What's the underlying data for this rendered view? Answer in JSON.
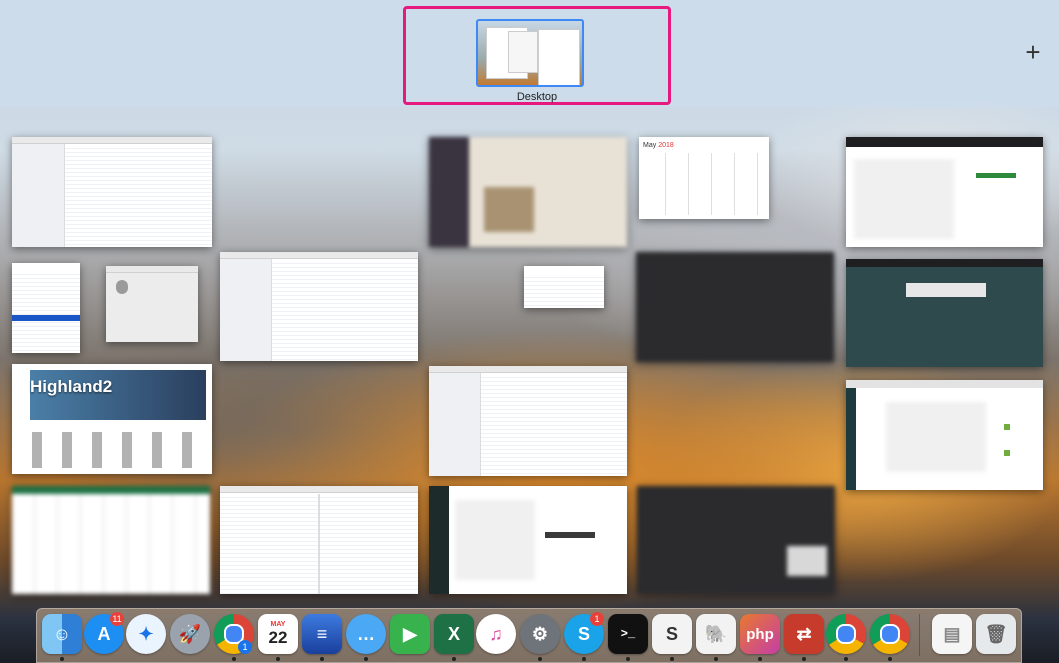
{
  "spaces": {
    "desktop_label": "Desktop",
    "add_button": "+"
  },
  "windows": {
    "highland_title": "Highland2",
    "calendar_month": "May",
    "calendar_year": "2018"
  },
  "dock": {
    "items": [
      {
        "name": "Finder",
        "icon": "finder-icon"
      },
      {
        "name": "App Store",
        "icon": "app-store-icon",
        "badge": "11"
      },
      {
        "name": "Safari",
        "icon": "safari-icon"
      },
      {
        "name": "Launchpad",
        "icon": "launchpad-icon"
      },
      {
        "name": "Chrome",
        "icon": "chrome-icon",
        "badge": "1"
      },
      {
        "name": "Calendar",
        "icon": "calendar-icon",
        "month": "MAY",
        "day": "22"
      },
      {
        "name": "Notes",
        "icon": "notes-icon"
      },
      {
        "name": "Messages",
        "icon": "messages-icon"
      },
      {
        "name": "FaceTime",
        "icon": "facetime-icon"
      },
      {
        "name": "Excel",
        "icon": "excel-icon"
      },
      {
        "name": "iTunes",
        "icon": "itunes-icon"
      },
      {
        "name": "System Preferences",
        "icon": "gear-icon"
      },
      {
        "name": "Skype",
        "icon": "skype-icon",
        "badge": "1"
      },
      {
        "name": "Terminal",
        "icon": "terminal-icon"
      },
      {
        "name": "Scrivener",
        "icon": "scrivener-icon"
      },
      {
        "name": "Evernote",
        "icon": "evernote-icon"
      },
      {
        "name": "PhpStorm",
        "icon": "php-icon",
        "label": "php"
      },
      {
        "name": "Remote Desktop",
        "icon": "remote-desktop-icon"
      },
      {
        "name": "Chrome Canary",
        "icon": "chrome-icon"
      },
      {
        "name": "Chrome",
        "icon": "chrome-icon"
      },
      {
        "name": "Document",
        "icon": "document-icon"
      },
      {
        "name": "Trash",
        "icon": "trash-icon"
      }
    ]
  }
}
